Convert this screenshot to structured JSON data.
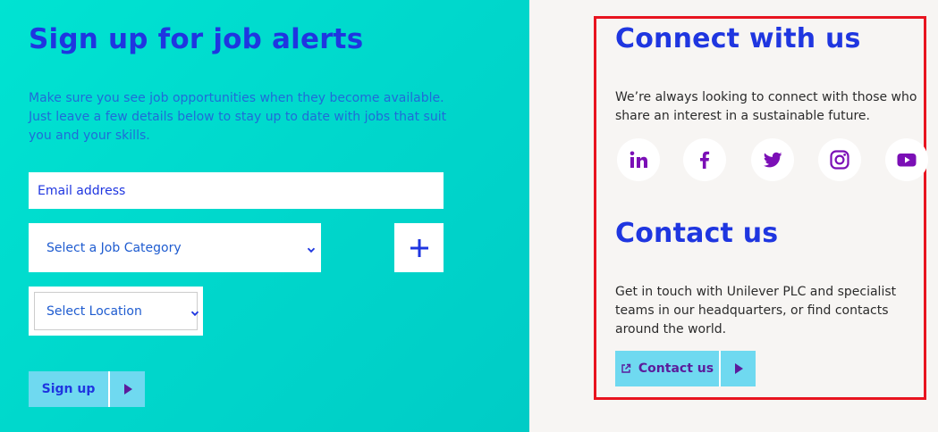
{
  "job_alerts": {
    "title": "Sign up for job alerts",
    "description": "Make sure you see job opportunities when they become available. Just leave a few details below to stay up to date with jobs that suit you and your skills.",
    "email_placeholder": "Email address",
    "job_category_selected": "Select a Job Category",
    "location_selected": "Select Location",
    "add_symbol": "+",
    "signup_label": "Sign up"
  },
  "connect": {
    "title": "Connect with us",
    "description": "We’re always looking to connect with those who share an interest in a sustainable future.",
    "socials": [
      "linkedin-icon",
      "facebook-icon",
      "twitter-icon",
      "instagram-icon",
      "youtube-icon"
    ]
  },
  "contact": {
    "title": "Contact us",
    "description": "Get in touch with Unilever PLC and specialist teams in our headquarters, or find contacts around the world.",
    "button_label": "Contact us"
  },
  "colors": {
    "heading_blue": "#1f36e0",
    "left_bg": "#00dccf",
    "button_bg": "#6fd9f0",
    "social_purple": "#7b0fb6",
    "highlight_red": "#e8141f"
  }
}
